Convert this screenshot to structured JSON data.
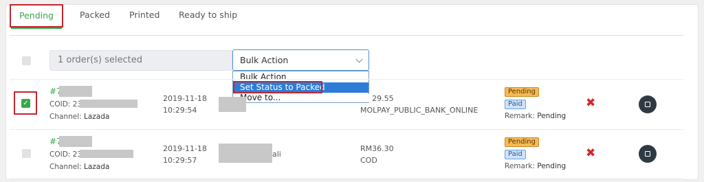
{
  "tabs": [
    {
      "label": "Pending"
    },
    {
      "label": "Packed"
    },
    {
      "label": "Printed"
    },
    {
      "label": "Ready to ship"
    }
  ],
  "toolbar": {
    "selected_text": "1 order(s) selected",
    "bulk_action_value": "Bulk Action",
    "dropdown_options": [
      "Bulk Action",
      "Set Status to Packed",
      "Move to..."
    ]
  },
  "orders": [
    {
      "id_prefix": "#7",
      "coid_label": "COID:",
      "coid_prefix": "23",
      "channel_label": "Channel:",
      "channel": "Lazada",
      "date": "2019-11-18",
      "time": "10:29:54",
      "customer_suffix": "",
      "amount": "RM29.55",
      "payment": "MOLPAY_PUBLIC_BANK_ONLINE",
      "status_badge": "Pending",
      "payment_badge": "Paid",
      "remark_label": "Remark:",
      "remark": "Pending",
      "checked": true
    },
    {
      "id_prefix": "#7",
      "coid_label": "COID:",
      "coid_prefix": "23",
      "channel_label": "Channel:",
      "channel": "Lazada",
      "date": "2019-11-18",
      "time": "10:29:57",
      "customer_suffix": "ali",
      "amount": "RM36.30",
      "payment": "COD",
      "status_badge": "Pending",
      "payment_badge": "Paid",
      "remark_label": "Remark:",
      "remark": "Pending",
      "checked": false
    }
  ],
  "icons": {
    "delete": "close-icon",
    "print": "printer-icon"
  },
  "colors": {
    "accent_green": "#3aa84a",
    "highlight_red": "#c0262d",
    "dropdown_highlight": "#2d7dd8",
    "badge_pending": "#f5b955",
    "badge_paid": "#cfe2f8"
  }
}
